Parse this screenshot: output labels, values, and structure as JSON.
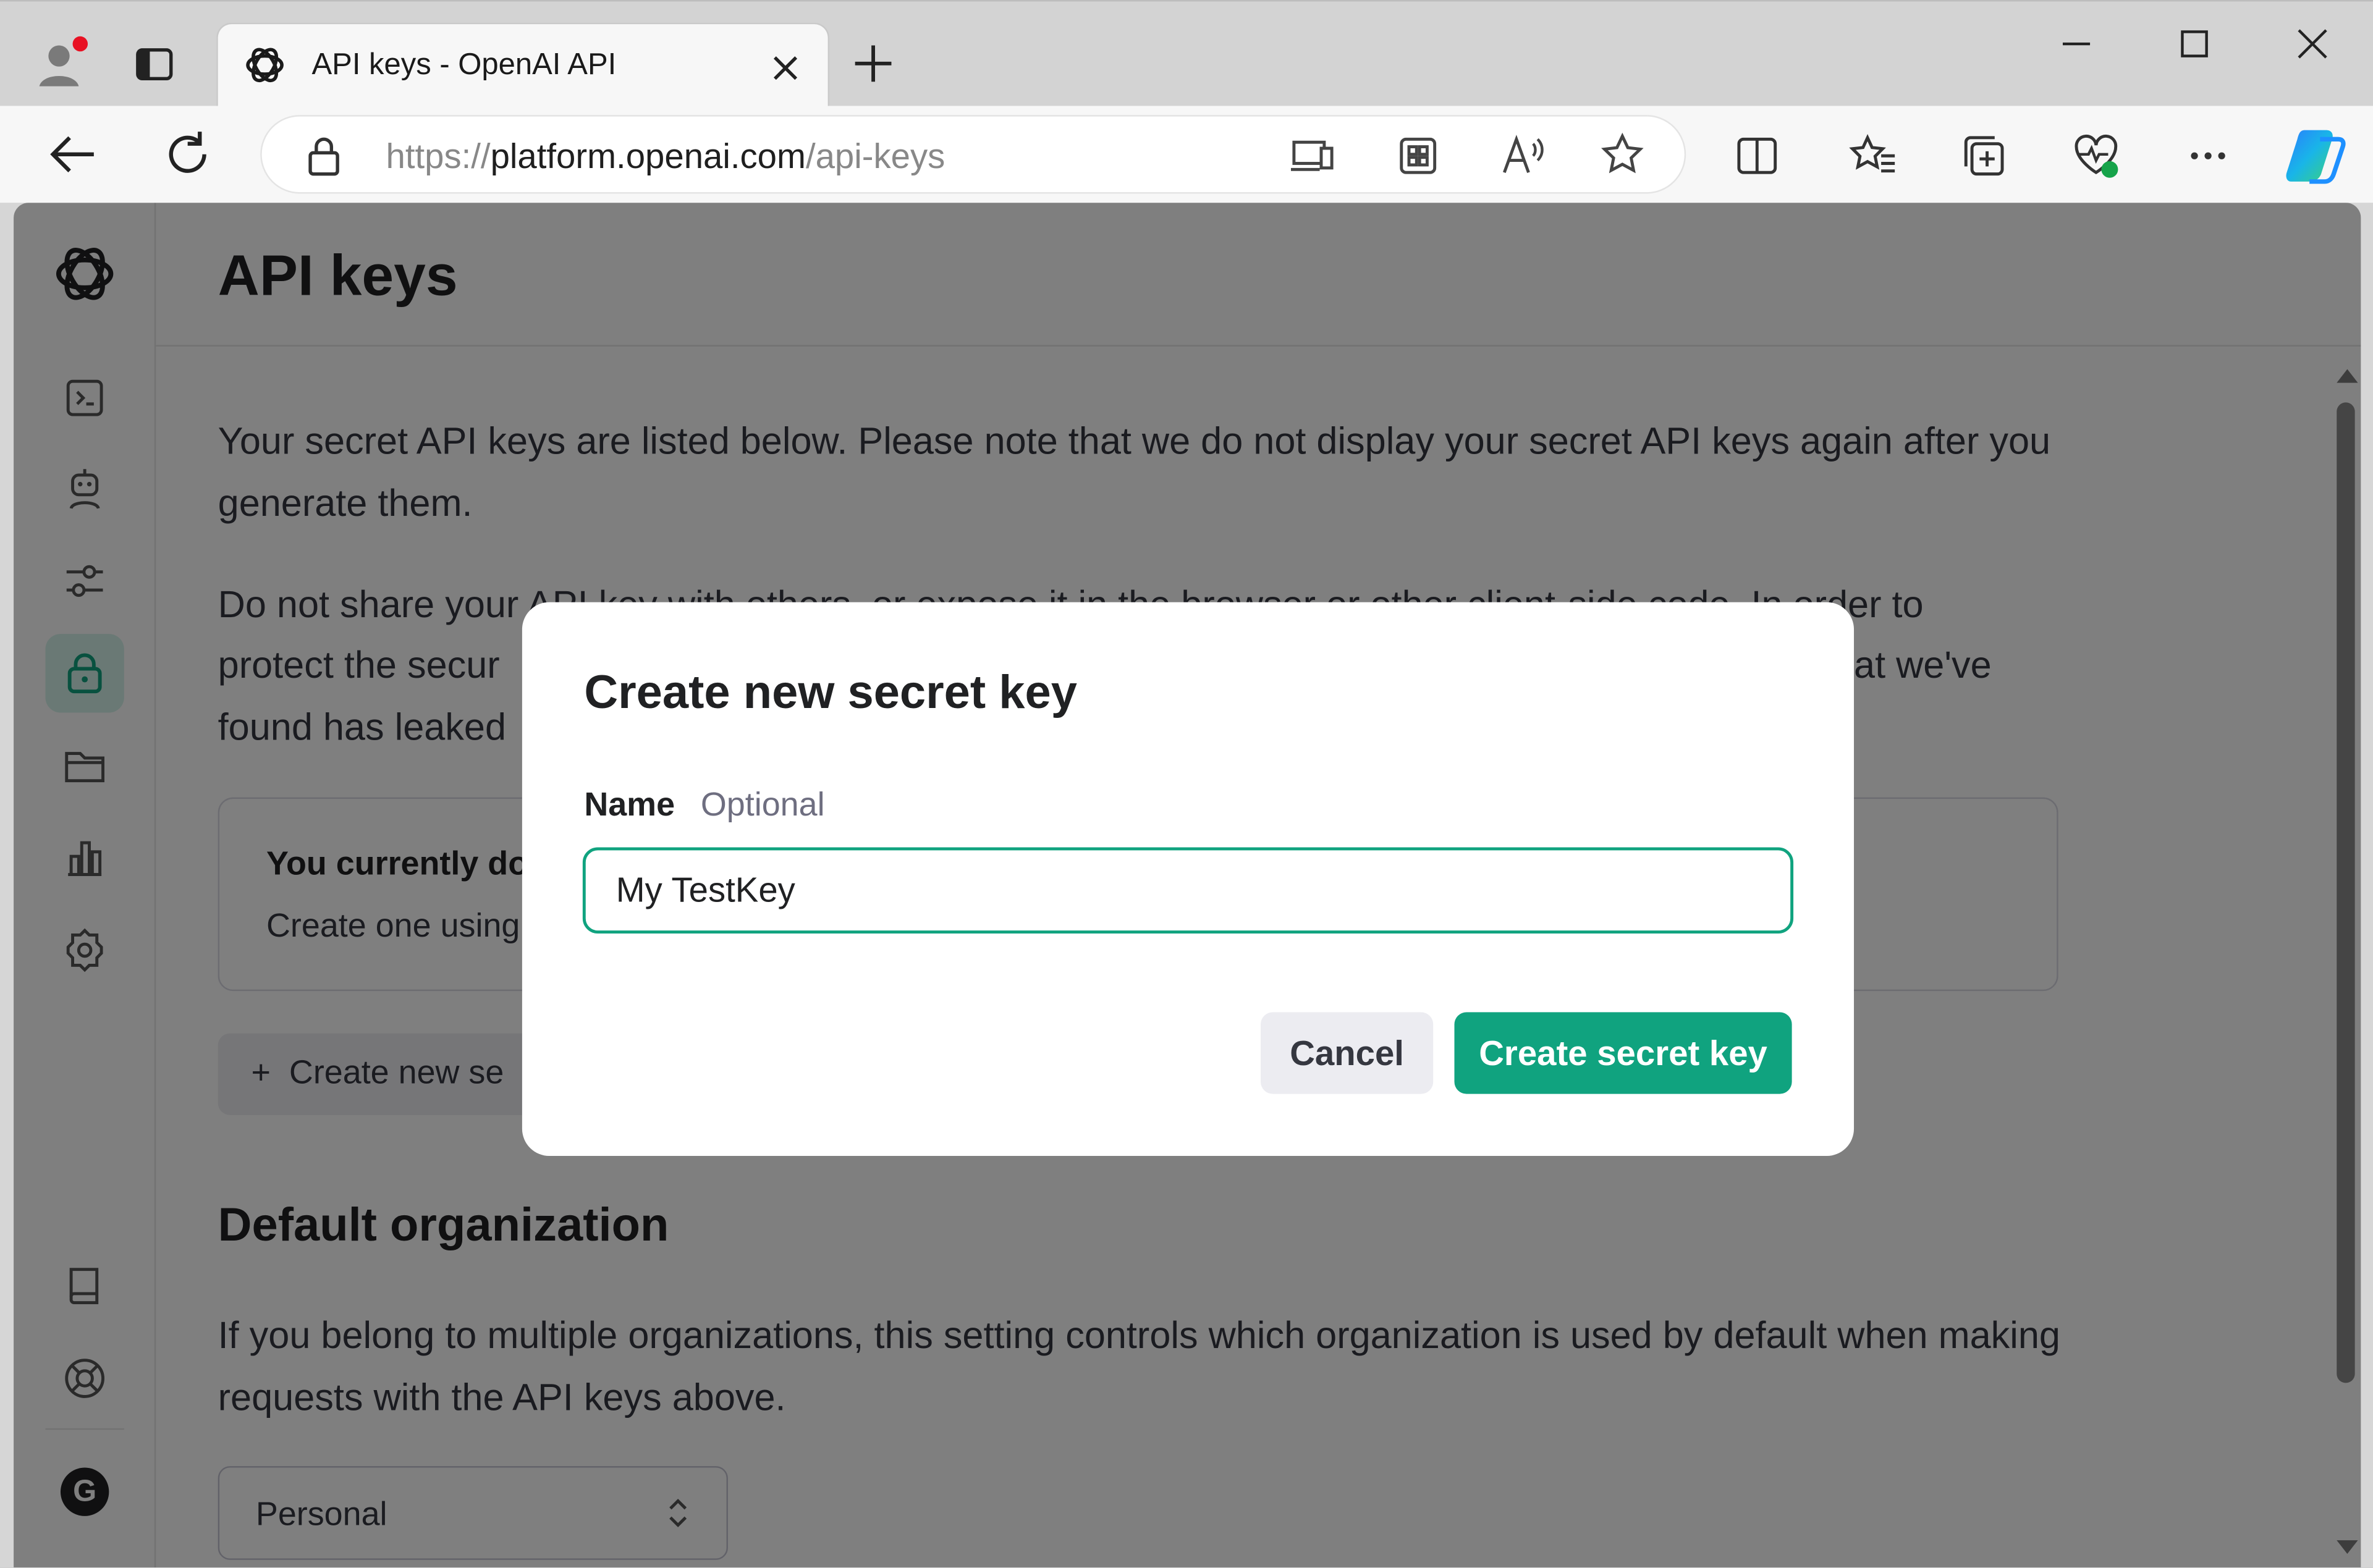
{
  "browser": {
    "tab_title": "API keys - OpenAI API",
    "url_prefix": "https://",
    "url_host": "platform.openai.com",
    "url_path": "/api-keys"
  },
  "sidebar": {
    "items": [
      "playground-icon",
      "assistants-icon",
      "fine-tuning-icon",
      "api-keys-icon",
      "storage-icon",
      "usage-icon",
      "settings-icon",
      "docs-icon",
      "help-icon"
    ],
    "active": "api-keys-icon",
    "avatar_letter": "G"
  },
  "page": {
    "title": "API keys",
    "intro": "Your secret API keys are listed below. Please note that we do not display your secret API keys again after you generate them.",
    "warning_line1": "Do not share your API key with others, or expose it in the browser or other client-side code. In order to",
    "warning_line2_left": "protect the secur",
    "warning_line2_right": "at we've",
    "warning_line3": "found has leaked",
    "notice_title": "You currently do",
    "notice_body": "Create one using",
    "create_button_partial": "+  Create new se",
    "default_org_title": "Default organization",
    "default_org_desc": "If you belong to multiple organizations, this setting controls which organization is used by default when making requests with the API keys above.",
    "org_select_value": "Personal"
  },
  "modal": {
    "title": "Create new secret key",
    "name_label": "Name",
    "name_hint": "Optional",
    "name_value": "My TestKey",
    "cancel_label": "Cancel",
    "submit_label": "Create secret key"
  },
  "colors": {
    "accent": "#10a37f",
    "overlay": "rgba(0,0,0,0.5)"
  }
}
